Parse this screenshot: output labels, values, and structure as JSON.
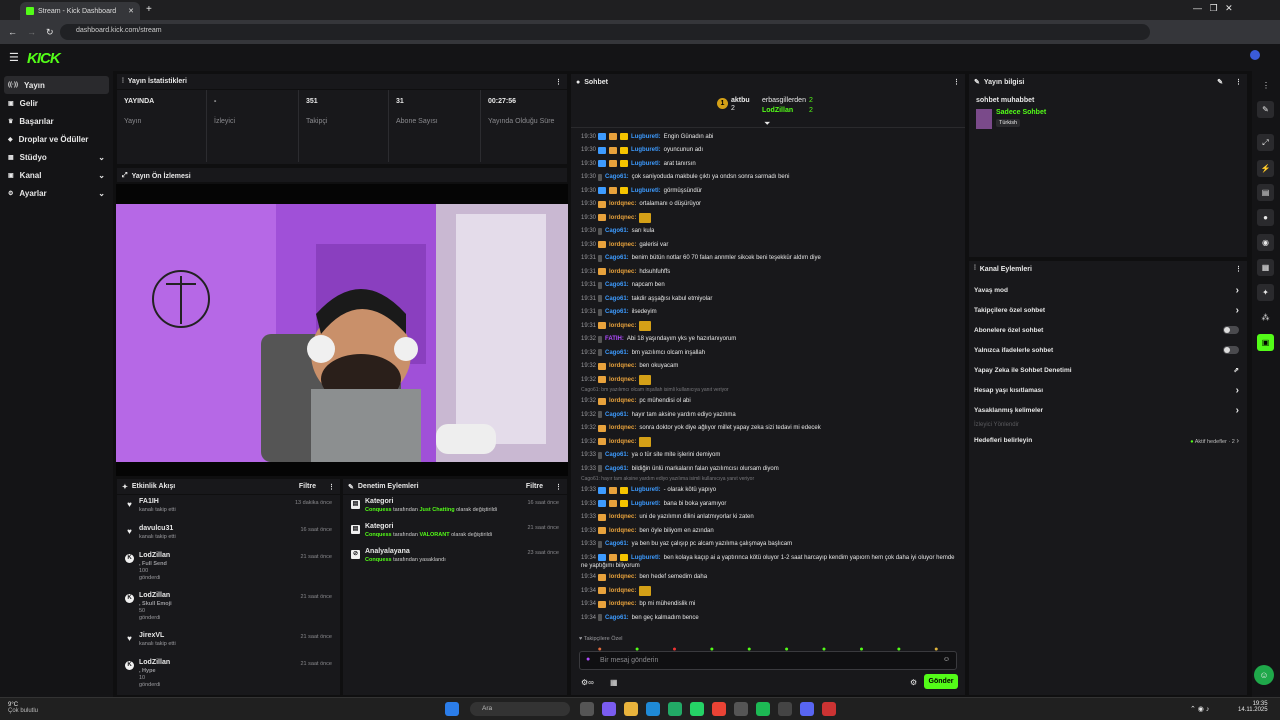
{
  "browser": {
    "tab_title": "Stream - Kick Dashboard",
    "url": "dashboard.kick.com/stream"
  },
  "logo": "KICK",
  "sidebar": {
    "items": [
      {
        "label": "Yayın",
        "icon": "broadcast-icon"
      },
      {
        "label": "Gelir",
        "icon": "money-icon"
      },
      {
        "label": "Başarılar",
        "icon": "trophy-icon"
      },
      {
        "label": "Droplar ve Ödüller",
        "icon": "gift-icon"
      },
      {
        "label": "Stüdyo",
        "icon": "studio-icon"
      },
      {
        "label": "Kanal",
        "icon": "channel-icon"
      },
      {
        "label": "Ayarlar",
        "icon": "gear-icon"
      }
    ]
  },
  "stats": {
    "title": "Yayın İstatistikleri",
    "items": [
      {
        "value": "YAYINDA",
        "label": "Yayın"
      },
      {
        "value": "-",
        "label": "İzleyici"
      },
      {
        "value": "351",
        "label": "Takipçi"
      },
      {
        "value": "31",
        "label": "Abone Sayısı"
      },
      {
        "value": "00:27:56",
        "label": "Yayında Olduğu Süre"
      }
    ]
  },
  "preview": {
    "title": "Yayın Ön İzlemesi"
  },
  "activity": {
    "title": "Etkinlik Akışı",
    "filter": "Filtre",
    "items": [
      {
        "name": "FA1IH",
        "sub": "kanalı takip etti",
        "time": "13 dakika önce",
        "icon": "♥"
      },
      {
        "name": "davulcu31",
        "sub": "kanalı takip etti",
        "time": "16 saat önce",
        "icon": "♥"
      },
      {
        "name": "LodZillan",
        "sub": ", Full Send",
        "sub2": "100",
        "sub3": "gönderdi",
        "time": "21 saat önce",
        "icon": "K"
      },
      {
        "name": "LodZillan",
        "sub": ", Skull Emoji",
        "sub2": "50",
        "sub3": "gönderdi",
        "time": "21 saat önce",
        "icon": "K"
      },
      {
        "name": "JirexVL",
        "sub": "kanalı takip etti",
        "time": "21 saat önce",
        "icon": "♥"
      },
      {
        "name": "LodZillan",
        "sub": ", Hype",
        "sub2": "10",
        "sub3": "gönderdi",
        "time": "21 saat önce",
        "icon": "K"
      }
    ]
  },
  "moderation": {
    "title": "Denetim Eylemleri",
    "filter": "Filtre",
    "items": [
      {
        "name": "Kategori",
        "actor": "Conquess",
        "mid": "tarafından",
        "target": "Just Chatting",
        "end": "olarak değiştirildi",
        "time": "16 saat önce"
      },
      {
        "name": "Kategori",
        "actor": "Conquess",
        "mid": "tarafından",
        "target": "VALORANT",
        "end": "olarak değiştirildi",
        "time": "21 saat önce"
      },
      {
        "name": "Analyalayana",
        "actor": "Conquess",
        "mid": "tarafından yasaklandı",
        "target": "",
        "end": "",
        "time": "23 saat önce"
      }
    ]
  },
  "chat": {
    "title": "Sohbet",
    "top": [
      {
        "rank": "1",
        "name": "aktbu",
        "count": "2"
      },
      {
        "name": "erbasgillerden",
        "count": "2"
      },
      {
        "name": "LodZillan",
        "count": "2"
      }
    ],
    "messages": [
      {
        "t": "19:30",
        "u": "Lugburetl:",
        "c": "#3d9bff",
        "m": "Engin Günadın abi"
      },
      {
        "t": "19:30",
        "u": "Lugburetl:",
        "c": "#3d9bff",
        "m": "oyuncunun adı"
      },
      {
        "t": "19:30",
        "u": "Lugburetl:",
        "c": "#3d9bff",
        "m": "arat tanırsın"
      },
      {
        "t": "19:30",
        "u": "Cago61:",
        "c": "#3d9bff",
        "m": "çok saniyoduda makbule çıktı ya ondsn sonra sarmadı beni"
      },
      {
        "t": "19:30",
        "u": "Lugburetl:",
        "c": "#3d9bff",
        "m": "görmüşsündür"
      },
      {
        "t": "19:30",
        "u": "lordqnec:",
        "c": "#e8a23c",
        "m": "ortalamanı o düşürüyor"
      },
      {
        "t": "19:30",
        "u": "lordqnec:",
        "c": "#e8a23c",
        "m": ""
      },
      {
        "t": "19:30",
        "u": "Cago61:",
        "c": "#3d9bff",
        "m": "sarı kula"
      },
      {
        "t": "19:30",
        "u": "lordqnec:",
        "c": "#e8a23c",
        "m": "galerisi var"
      },
      {
        "t": "19:31",
        "u": "Cago61:",
        "c": "#3d9bff",
        "m": "benim bütün notlar 60 70 falan annmler sikcek beni teşekkür aldım diye"
      },
      {
        "t": "19:31",
        "u": "lordqnec:",
        "c": "#e8a23c",
        "m": "hdsuhfuhffs"
      },
      {
        "t": "19:31",
        "u": "Cago61:",
        "c": "#3d9bff",
        "m": "napcam ben"
      },
      {
        "t": "19:31",
        "u": "Cago61:",
        "c": "#3d9bff",
        "m": "takdir aşşağısı kabul etmiyolar"
      },
      {
        "t": "19:31",
        "u": "Cago61:",
        "c": "#3d9bff",
        "m": "ilsedeyim"
      },
      {
        "t": "19:31",
        "u": "lordqnec:",
        "c": "#e8a23c",
        "m": ""
      },
      {
        "t": "19:32",
        "u": "FATIH:",
        "c": "#b04bff",
        "m": "Abi 18 yaşındayım yks ye hazırlanıyorum"
      },
      {
        "t": "19:32",
        "u": "Cago61:",
        "c": "#3d9bff",
        "m": "bm yazılımcı olcam inşallah"
      },
      {
        "t": "19:32",
        "u": "lordqnec:",
        "c": "#e8a23c",
        "m": "ben okuyacam"
      },
      {
        "t": "19:32",
        "u": "lordqnec:",
        "c": "#e8a23c",
        "m": ""
      },
      {
        "reply": "Cago61: bm yazılımcı olcam inşallah isimli kullanıcıya yanıt veriyor"
      },
      {
        "t": "19:32",
        "u": "lordqnec:",
        "c": "#e8a23c",
        "m": "pc mühendisi ol abi"
      },
      {
        "t": "19:32",
        "u": "Cago61:",
        "c": "#3d9bff",
        "m": "hayır tam aksine yardım ediyo yazılıma"
      },
      {
        "t": "19:32",
        "u": "lordqnec:",
        "c": "#e8a23c",
        "m": "sonra doktor yok diye ağlıyor millet yapay zeka sizi tedavi mi edecek"
      },
      {
        "t": "19:32",
        "u": "lordqnec:",
        "c": "#e8a23c",
        "m": ""
      },
      {
        "t": "19:33",
        "u": "Cago61:",
        "c": "#3d9bff",
        "m": "ya o tür site mite işlerini demiyom"
      },
      {
        "t": "19:33",
        "u": "Cago61:",
        "c": "#3d9bff",
        "m": "bildiğin ünlü markaların falan yazılımcısı olursam diyom"
      },
      {
        "reply": "Cago61: hayır tam aksine yardım ediyo yazılıma isimli kullanıcıya yanıt veriyor"
      },
      {
        "t": "19:33",
        "u": "Lugburetl:",
        "c": "#3d9bff",
        "m": "- olarak kötü yapıyo"
      },
      {
        "t": "19:33",
        "u": "Lugburetl:",
        "c": "#3d9bff",
        "m": "bana bi boka yaramıyor"
      },
      {
        "t": "19:33",
        "u": "lordqnec:",
        "c": "#e8a23c",
        "m": "uni de yazılımın dilini anlatmıyorlar ki zaten"
      },
      {
        "t": "19:33",
        "u": "lordqnec:",
        "c": "#e8a23c",
        "m": "ben öyle biliyom en azından"
      },
      {
        "t": "19:33",
        "u": "Cago61:",
        "c": "#3d9bff",
        "m": "ya ben bu yaz çalışıp pc alcam yazılıma çalışmaya başlıcam"
      },
      {
        "t": "19:34",
        "u": "Lugburetl:",
        "c": "#3d9bff",
        "m": "ben kolaya kaçıp ai a yaptırınca kötü oluyor 1-2 saat harcayıp kendim yapıorn hem çok daha iyi oluyor hemde"
      },
      {
        "cont": "ne yaptığımı biliyorum"
      },
      {
        "t": "19:34",
        "u": "lordqnec:",
        "c": "#e8a23c",
        "m": "ben hedef semedim daha"
      },
      {
        "t": "19:34",
        "u": "lordqnec:",
        "c": "#e8a23c",
        "m": ""
      },
      {
        "t": "19:34",
        "u": "lordqnec:",
        "c": "#e8a23c",
        "m": "bp mi mühendislik mi"
      },
      {
        "t": "19:34",
        "u": "Cago61:",
        "c": "#3d9bff",
        "m": "ben geç kalmadım bence"
      }
    ],
    "mode": "Takipçilere Özel",
    "placeholder": "Bir mesaj gönderin",
    "send": "Gönder"
  },
  "stream_info": {
    "title": "Yayın bilgisi",
    "stream_title": "sohbet muhabbet",
    "category": "Sadece Sohbet",
    "tag": "Türkish"
  },
  "channel_actions": {
    "title": "Kanal Eylemleri",
    "items": [
      {
        "label": "Yavaş mod",
        "ctl": "chevron"
      },
      {
        "label": "Takipçilere özel sohbet",
        "ctl": "chevron"
      },
      {
        "label": "Abonelere özel sohbet",
        "ctl": "toggle"
      },
      {
        "label": "Yalnızca ifadelerle sohbet",
        "ctl": "toggle"
      },
      {
        "label": "Yapay Zeka ile Sohbet Denetimi",
        "ctl": "ext"
      },
      {
        "label": "Hesap yaşı kısıtlaması",
        "ctl": "chevron"
      },
      {
        "label": "Yasaklanmış kelimeler",
        "ctl": "chevron"
      }
    ],
    "section": "İzleyici Yönlendir",
    "goal_label": "Hedefleri belirleyin",
    "goal_status": "Aktif hedefler · 2"
  },
  "taskbar": {
    "weather_temp": "9°C",
    "weather_desc": "Çok bulutlu",
    "search": "Ara",
    "time": "19:35",
    "date": "14.11.2025"
  }
}
